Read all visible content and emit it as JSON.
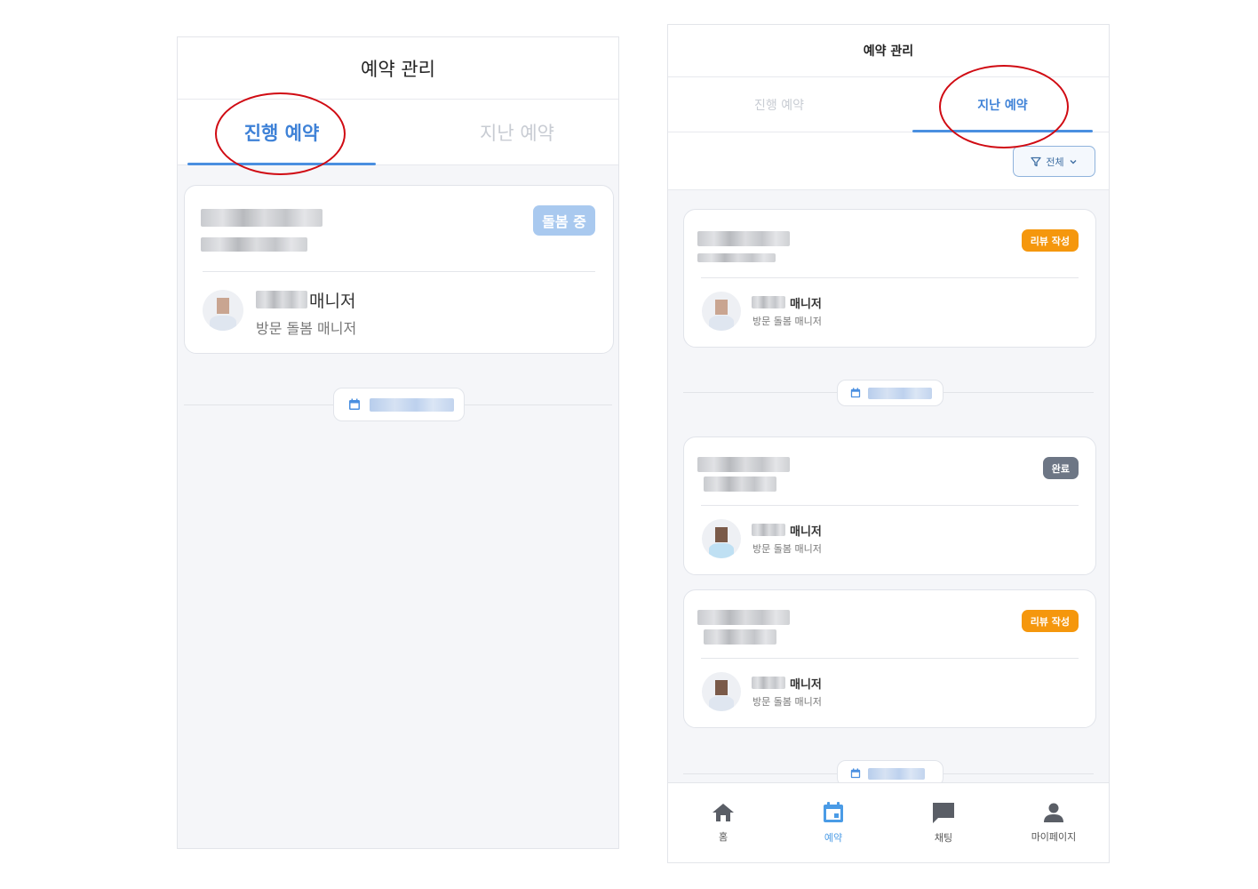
{
  "left_screen": {
    "header_title": "예약 관리",
    "tabs": [
      {
        "label": "진행 예약",
        "active": true
      },
      {
        "label": "지난 예약",
        "active": false
      }
    ],
    "card": {
      "status_badge": "돌봄 중",
      "manager_name_suffix": "매니저",
      "manager_role": "방문 돌봄 매니저"
    }
  },
  "right_screen": {
    "header_title": "예약 관리",
    "tabs": [
      {
        "label": "진행 예약",
        "active": false
      },
      {
        "label": "지난 예약",
        "active": true
      }
    ],
    "filter": {
      "label": "전체",
      "icon": "filter-icon"
    },
    "cards": [
      {
        "status_badge": "리뷰 작성",
        "manager_name_suffix": "매니저",
        "manager_role": "방문 돌봄 매니저"
      },
      {
        "status_badge": "완료",
        "manager_name_suffix": "매니저",
        "manager_role": "방문 돌봄 매니저"
      },
      {
        "status_badge": "리뷰 작성",
        "manager_name_suffix": "매니저",
        "manager_role": "방문 돌봄 매니저"
      }
    ],
    "bottom_nav": [
      {
        "label": "홈",
        "icon": "home-icon",
        "active": false
      },
      {
        "label": "예약",
        "icon": "calendar-icon",
        "active": true
      },
      {
        "label": "채팅",
        "icon": "chat-icon",
        "active": false
      },
      {
        "label": "마이페이지",
        "icon": "person-icon",
        "active": false
      }
    ]
  },
  "colors": {
    "accent": "#4a8fe0",
    "badge_in_progress": "#a9c9ef",
    "badge_review": "#f5970d",
    "badge_done": "#6d7685",
    "highlight_circle": "#d00b13"
  }
}
